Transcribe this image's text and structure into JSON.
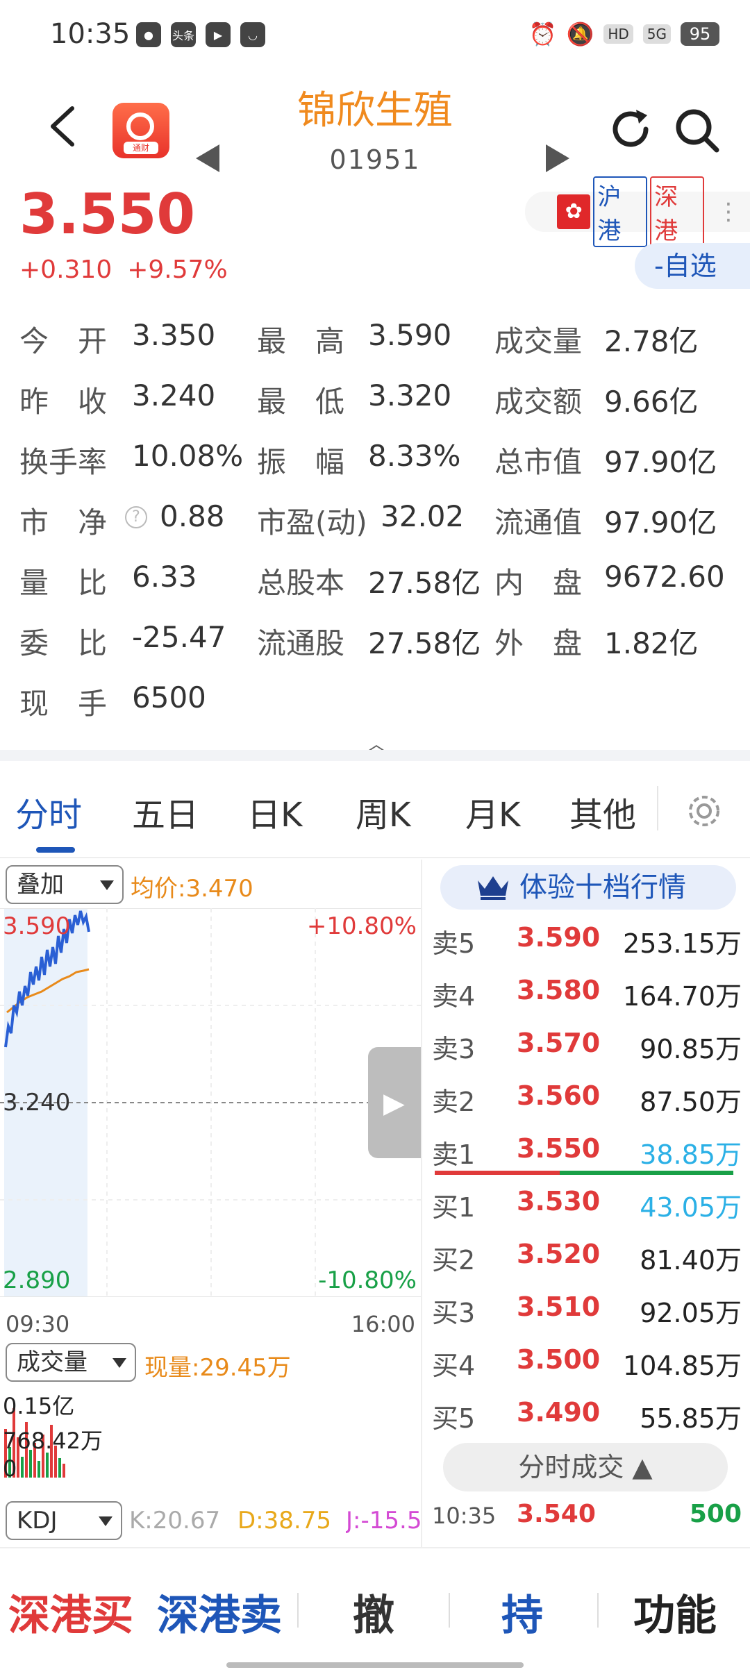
{
  "status_bar": {
    "time": "10:35",
    "left_icons": [
      "wechat-icon",
      "toutiao-icon",
      "video-icon",
      "shop-icon"
    ],
    "toutiao_label": "头条",
    "network": "5G",
    "hd": "HD",
    "battery": "95"
  },
  "header": {
    "stock_name": "锦欣生殖",
    "stock_code": "01951",
    "app_tag": "通财"
  },
  "quote": {
    "price": "3.550",
    "change": "+0.310",
    "change_pct": "+9.57%",
    "badge_hgt": "沪港",
    "badge_sgt": "深港",
    "hk_flag": "✿",
    "watchlist_btn": "-自选"
  },
  "stats": {
    "rows": [
      [
        {
          "label": "今　开",
          "value": "3.350"
        },
        {
          "label": "最　高",
          "value": "3.590"
        },
        {
          "label": "成交量",
          "value": "2.78亿"
        }
      ],
      [
        {
          "label": "昨　收",
          "value": "3.240"
        },
        {
          "label": "最　低",
          "value": "3.320"
        },
        {
          "label": "成交额",
          "value": "9.66亿"
        }
      ],
      [
        {
          "label": "换手率",
          "value": "10.08%"
        },
        {
          "label": "振　幅",
          "value": "8.33%"
        },
        {
          "label": "总市值",
          "value": "97.90亿"
        }
      ],
      [
        {
          "label": "市　净",
          "value": "0.88"
        },
        {
          "label": "市盈(动)",
          "value": "32.02"
        },
        {
          "label": "流通值",
          "value": "97.90亿"
        }
      ],
      [
        {
          "label": "量　比",
          "value": "6.33"
        },
        {
          "label": "总股本",
          "value": "27.58亿"
        },
        {
          "label": "内　盘",
          "value": "9672.60"
        }
      ],
      [
        {
          "label": "委　比",
          "value": "-25.47"
        },
        {
          "label": "流通股",
          "value": "27.58亿"
        },
        {
          "label": "外　盘",
          "value": "1.82亿"
        }
      ],
      [
        {
          "label": "现　手",
          "value": "6500"
        }
      ]
    ]
  },
  "tabs": [
    "分时",
    "五日",
    "日K",
    "周K",
    "月K",
    "其他"
  ],
  "chart": {
    "overlay_select": "叠加",
    "avg_price": "均价:3.470",
    "y_top": "3.590",
    "y_mid": "3.240",
    "y_bottom": "2.890",
    "pct_top": "+10.80%",
    "pct_bottom": "-10.80%",
    "time_start": "09:30",
    "time_end": "16:00",
    "volume_select": "成交量",
    "current_volume": "现量:29.45万",
    "vol_top": "0.15亿",
    "vol_mid": "768.42万",
    "vol_zero": "0",
    "kdj_select": "KDJ",
    "k": "K:20.67",
    "d": "D:38.75",
    "j": "J:-15.5",
    "colors": {
      "price_line": "#2a5fd4",
      "avg_line": "#e88a1a",
      "up": "#e03a3a",
      "down": "#18a047"
    }
  },
  "order_book": {
    "header": "体验十档行情",
    "asks": [
      {
        "label": "卖5",
        "price": "3.590",
        "volume": "253.15万"
      },
      {
        "label": "卖4",
        "price": "3.580",
        "volume": "164.70万"
      },
      {
        "label": "卖3",
        "price": "3.570",
        "volume": "90.85万"
      },
      {
        "label": "卖2",
        "price": "3.560",
        "volume": "87.50万"
      },
      {
        "label": "卖1",
        "price": "3.550",
        "volume": "38.85万"
      }
    ],
    "bids": [
      {
        "label": "买1",
        "price": "3.530",
        "volume": "43.05万"
      },
      {
        "label": "买2",
        "price": "3.520",
        "volume": "81.40万"
      },
      {
        "label": "买3",
        "price": "3.510",
        "volume": "92.05万"
      },
      {
        "label": "买4",
        "price": "3.500",
        "volume": "104.85万"
      },
      {
        "label": "买5",
        "price": "3.490",
        "volume": "55.85万"
      }
    ],
    "ticks_button": "分时成交 ▲",
    "tick": {
      "time": "10:35",
      "price": "3.540",
      "volume": "500"
    }
  },
  "bottom_bar": {
    "buy": "深港买",
    "sell": "深港卖",
    "cancel": "撤",
    "hold": "持",
    "functions": "功能"
  }
}
